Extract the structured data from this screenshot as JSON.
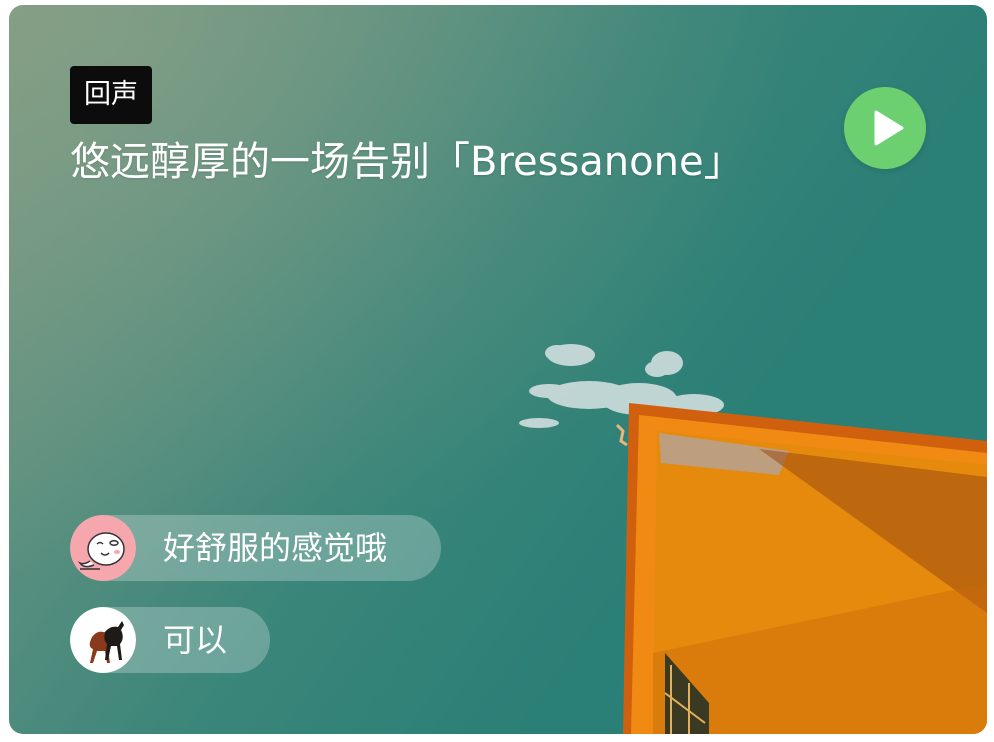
{
  "card": {
    "tag": "回声",
    "title": "悠远醇厚的一场告别「Bressanone」",
    "play_icon": "play-icon",
    "accent_play": "#6dd070"
  },
  "comments": [
    {
      "avatar": "cartoon-face-avatar",
      "text": "好舒服的感觉哦"
    },
    {
      "avatar": "horses-avatar",
      "text": "可以"
    }
  ]
}
